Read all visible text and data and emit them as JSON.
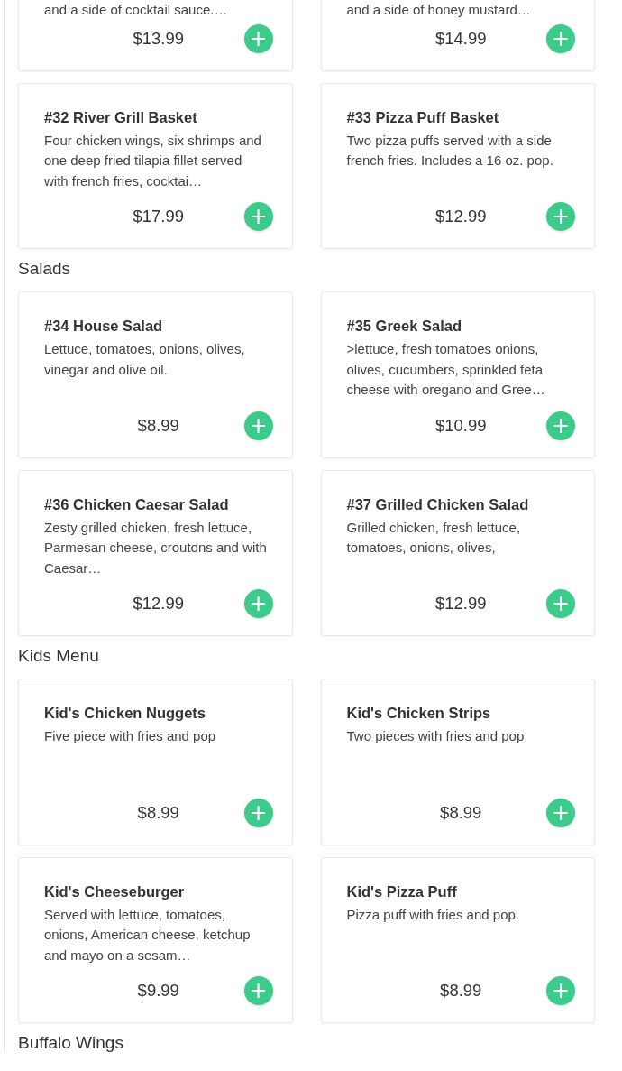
{
  "sections": [
    {
      "items": [
        {
          "description": "and a side of cocktail sauce.…",
          "price": "$13.99",
          "add": "+"
        },
        {
          "description": "and a side of honey mustard…",
          "price": "$14.99",
          "add": "+"
        },
        {
          "title": "#32 River Grill Basket",
          "description": "Four chicken wings, six shrimps and one deep fried tilapia fillet served with french fries, cocktai…",
          "price": "$17.99",
          "add": "+"
        },
        {
          "title": "#33 Pizza Puff Basket",
          "description": "Two pizza puffs served with a side french fries. Includes a 16 oz. pop.",
          "price": "$12.99",
          "add": "+"
        }
      ]
    },
    {
      "heading": "Salads",
      "items": [
        {
          "title": "#34 House Salad",
          "description": "Lettuce, tomatoes, onions, olives, vinegar and olive oil.",
          "price": "$8.99",
          "add": "+"
        },
        {
          "title": "#35 Greek Salad",
          "description": ">lettuce, fresh tomatoes onions, olives, cucumbers, sprinkled feta cheese with oregano and Gree…",
          "price": "$10.99",
          "add": "+"
        },
        {
          "title": "#36 Chicken Caesar Salad",
          "description": "Zesty grilled chicken, fresh lettuce, Parmesan cheese, croutons and with Caesar…",
          "price": "$12.99",
          "add": "+"
        },
        {
          "title": "#37 Grilled Chicken Salad",
          "description": "Grilled chicken, fresh lettuce, tomatoes, onions, olives,",
          "price": "$12.99",
          "add": "+"
        }
      ]
    },
    {
      "heading": "Kids Menu",
      "items": [
        {
          "title": "Kid's Chicken Nuggets",
          "description": "Five piece with fries and pop",
          "price": "$8.99",
          "add": "+"
        },
        {
          "title": "Kid's Chicken Strips",
          "description": "Two pieces with fries and pop",
          "price": "$8.99",
          "add": "+"
        },
        {
          "title": "Kid's Cheeseburger",
          "description": "Served with lettuce, tomatoes, onions, American cheese, ketchup and mayo on a sesam…",
          "price": "$9.99",
          "add": "+"
        },
        {
          "title": "Kid's Pizza Puff",
          "description": "Pizza puff with fries and pop.",
          "price": "$8.99",
          "add": "+"
        }
      ]
    },
    {
      "heading": "Buffalo Wings"
    }
  ]
}
